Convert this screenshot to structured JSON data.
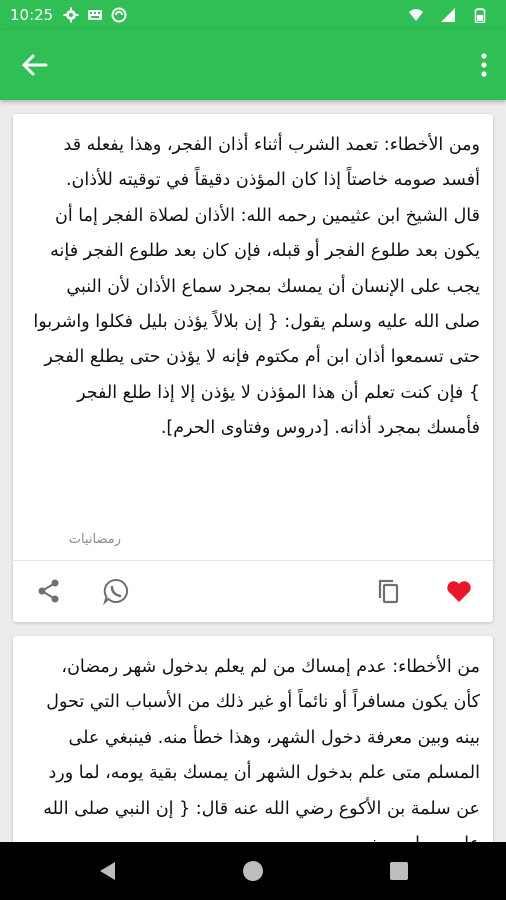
{
  "status_bar": {
    "time": "10:25",
    "icons": [
      "gear-icon",
      "keyboard-icon",
      "vpn-icon",
      "wifi-icon",
      "signal-icon",
      "battery-icon"
    ]
  },
  "app_bar": {
    "background": "#2fbf55",
    "back_icon": "arrow-left-icon",
    "menu_icon": "more-vert-icon"
  },
  "cards": [
    {
      "text": "ومن الأخطاء: تعمد الشرب أثناء أذان الفجر، وهذا يفعله قد أفسد صومه خاصتاً إذا كان المؤذن دقيقاً في توقيته للأذان.\nقال الشيخ ابن عثيمين رحمه الله: الأذان لصلاة الفجر إما أن يكون بعد طلوع الفجر أو قبله، فإن كان بعد طلوع الفجر فإنه يجب على الإنسان أن يمسك بمجرد سماع الأذان لأن النبي صلى الله عليه وسلم يقول: { إن بلالاً يؤذن بليل فكلوا واشربوا حتى تسمعوا أذان ابن أم مكتوم فإنه لا يؤذن حتى يطلع الفجر } فإن كنت تعلم أن هذا المؤذن لا يؤذن إلا إذا طلع الفجر فأمسك بمجرد أذانه. [دروس وفتاوى الحرم].",
      "category": "رمضانيات",
      "favorite_color": "#e8172c"
    },
    {
      "text": "من الأخطاء: عدم إمساك من لم يعلم بدخول شهر رمضان، كأن يكون مسافراً أو نائماً أو غير ذلك من الأسباب التي تحول بينه وبين معرفة دخول الشهر، وهذا خطأ منه. فينبغي على المسلم متى علم بدخول الشهر أن يمسك بقية يومه، لما ورد عن سلمة بن الأكوع رضي الله عنه قال: { إن النبي صلى الله عليه وسلم بعث"
    }
  ],
  "nav_bar": {
    "icons": [
      "back-triangle-icon",
      "home-circle-icon",
      "recents-square-icon"
    ]
  }
}
